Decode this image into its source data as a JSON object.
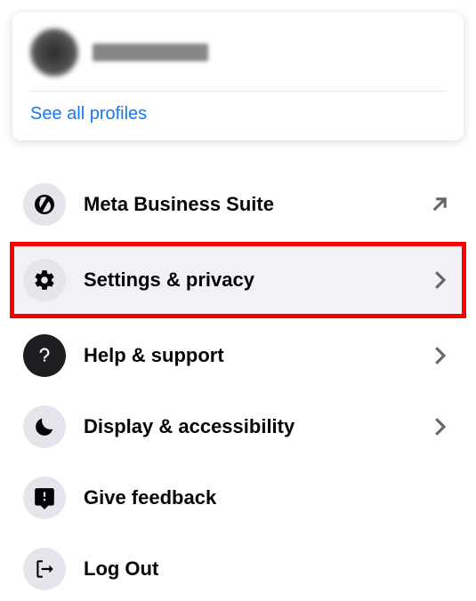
{
  "profile_card": {
    "see_all_label": "See all profiles"
  },
  "menu": [
    {
      "id": "meta-business",
      "label": "Meta Business Suite",
      "icon": "meta-business-icon",
      "accessory": "external"
    },
    {
      "id": "settings-privacy",
      "label": "Settings & privacy",
      "icon": "gear-icon",
      "accessory": "chevron",
      "highlighted": true
    },
    {
      "id": "help-support",
      "label": "Help & support",
      "icon": "question-icon",
      "accessory": "chevron"
    },
    {
      "id": "display-accessibility",
      "label": "Display & accessibility",
      "icon": "moon-icon",
      "accessory": "chevron"
    },
    {
      "id": "give-feedback",
      "label": "Give feedback",
      "icon": "feedback-icon",
      "accessory": "none"
    },
    {
      "id": "log-out",
      "label": "Log Out",
      "icon": "logout-icon",
      "accessory": "none"
    }
  ]
}
